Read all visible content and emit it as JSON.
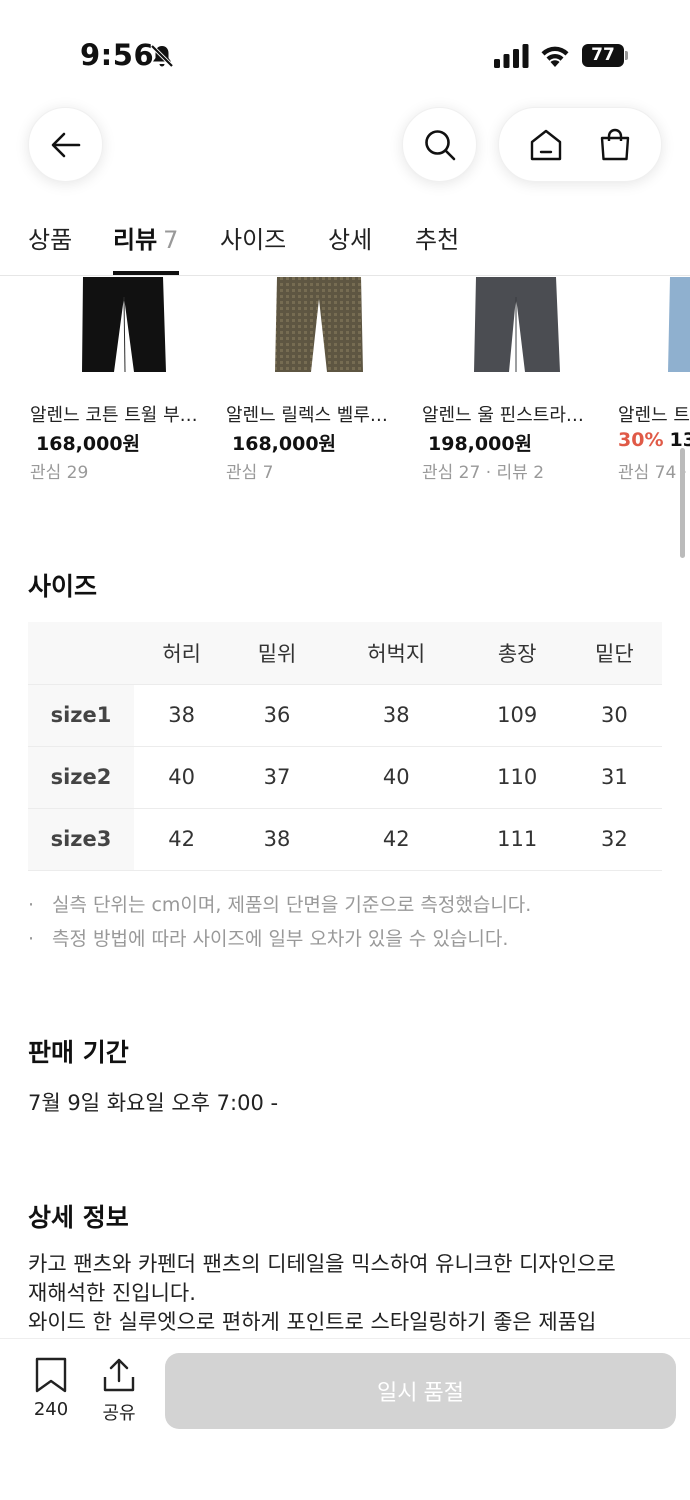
{
  "status_bar": {
    "time": "9:56",
    "battery": "77"
  },
  "nav": {
    "back_icon": "arrow-left-icon",
    "search_icon": "search-icon",
    "home_icon": "home-icon",
    "bag_icon": "shopping-bag-icon"
  },
  "tabs": [
    {
      "label": "상품",
      "count": ""
    },
    {
      "label": "리뷰",
      "count": "7"
    },
    {
      "label": "사이즈",
      "count": ""
    },
    {
      "label": "상세",
      "count": ""
    },
    {
      "label": "추천",
      "count": ""
    }
  ],
  "active_tab": "리뷰",
  "products": [
    {
      "name": "알렌느 코튼 트윌 부…",
      "discount": "",
      "price": "168,000원",
      "meta": "관심 29"
    },
    {
      "name": "알렌느 릴렉스 벨루…",
      "discount": "",
      "price": "168,000원",
      "meta": "관심 7"
    },
    {
      "name": "알렌느 울 핀스트라…",
      "discount": "",
      "price": "198,000원",
      "meta": "관심 27 · 리뷰 2"
    },
    {
      "name": "알렌느 트",
      "discount": "30%",
      "price": "13",
      "meta": "관심 74 ·"
    }
  ],
  "size_section": {
    "title": "사이즈",
    "columns": [
      "허리",
      "밑위",
      "허벅지",
      "총장",
      "밑단"
    ],
    "rows": [
      {
        "label": "size1",
        "values": [
          "38",
          "36",
          "38",
          "109",
          "30"
        ]
      },
      {
        "label": "size2",
        "values": [
          "40",
          "37",
          "40",
          "110",
          "31"
        ]
      },
      {
        "label": "size3",
        "values": [
          "42",
          "38",
          "42",
          "111",
          "32"
        ]
      }
    ],
    "notes": [
      "실측 단위는 cm이며, 제품의 단면을 기준으로 측정했습니다.",
      "측정 방법에 따라 사이즈에 일부 오차가 있을 수 있습니다."
    ]
  },
  "sale_period": {
    "title": "판매 기간",
    "value": "7월 9일 화요일 오후 7:00 -"
  },
  "details": {
    "title": "상세 정보",
    "lines": [
      "카고 팬츠와 카펜더 팬츠의 디테일을 믹스하여 유니크한 디자인으로",
      "재해석한 진입니다.",
      "와이드 한 실루엣으로 편하게 포인트로 스타일링하기 좋은 제품입"
    ]
  },
  "bottom_bar": {
    "bookmark_count": "240",
    "share_label": "공유",
    "soldout_label": "일시 품절"
  },
  "colors": {
    "discount": "#e05a47",
    "disabled_button": "#d3d3d3"
  }
}
